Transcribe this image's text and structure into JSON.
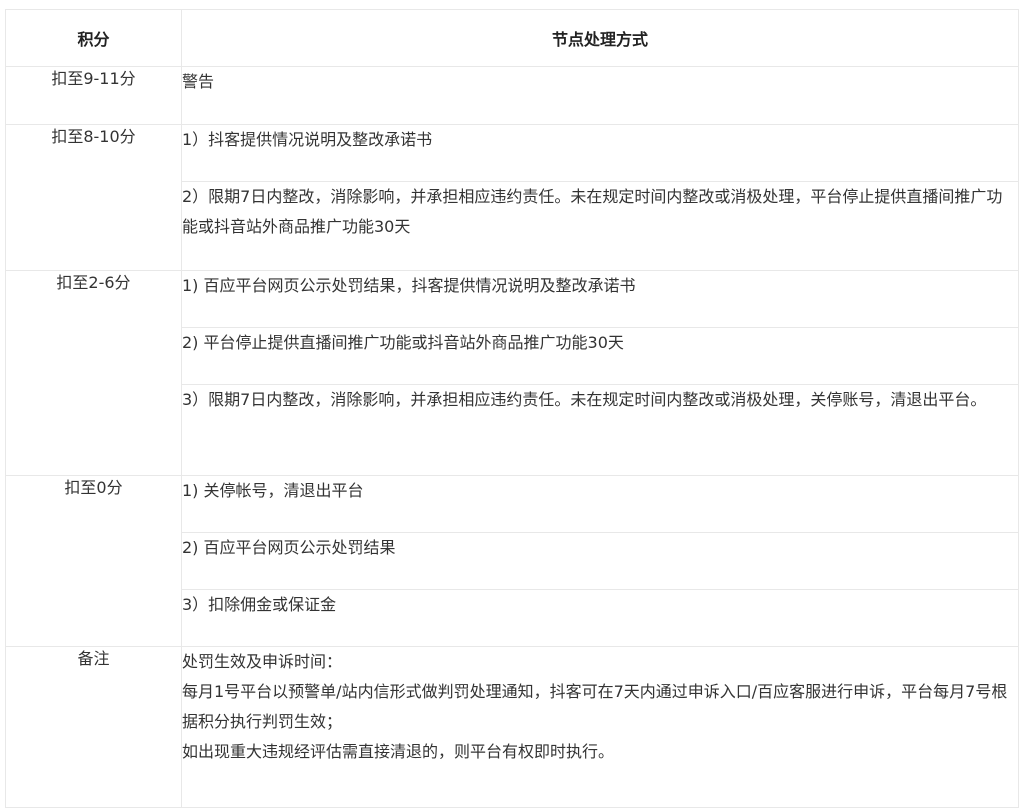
{
  "table": {
    "headers": [
      "积分",
      "节点处理方式"
    ],
    "groups": [
      {
        "score": "扣至9-11分",
        "items": [
          "警告"
        ]
      },
      {
        "score": "扣至8-10分",
        "items": [
          "1）抖客提供情况说明及整改承诺书",
          "2）限期7日内整改，消除影响，并承担相应违约责任。未在规定时间内整改或消极处理，平台停止提供直播间推广功能或抖音站外商品推广功能30天"
        ]
      },
      {
        "score": "扣至2-6分",
        "items": [
          "1) 百应平台网页公示处罚结果，抖客提供情况说明及整改承诺书",
          "2) 平台停止提供直播间推广功能或抖音站外商品推广功能30天",
          "3）限期7日内整改，消除影响，并承担相应违约责任。未在规定时间内整改或消极处理，关停账号，清退出平台。"
        ]
      },
      {
        "score": "扣至0分",
        "items": [
          "1) 关停帐号，清退出平台",
          "2) 百应平台网页公示处罚结果",
          "3）扣除佣金或保证金"
        ]
      }
    ],
    "notes": {
      "label": "备注",
      "lines": [
        "处罚生效及申诉时间：",
        "每月1号平台以预警单/站内信形式做判罚处理通知，抖客可在7天内通过申诉入口/百应客服进行申诉，平台每月7号根据积分执行判罚生效；",
        "如出现重大违规经评估需直接清退的，则平台有权即时执行。"
      ]
    }
  }
}
